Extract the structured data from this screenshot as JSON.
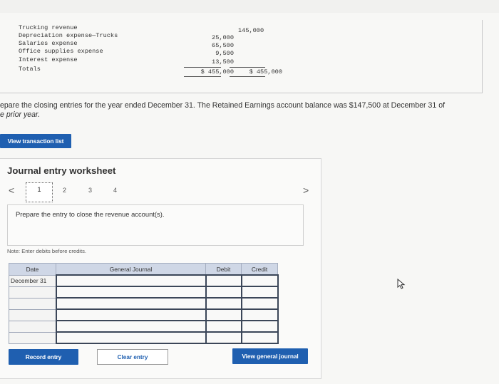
{
  "trial_balance": {
    "rows": [
      {
        "label": "Trucking revenue",
        "debit": "",
        "credit": "145,000"
      },
      {
        "label": "Depreciation expense—Trucks",
        "debit": "25,000",
        "credit": ""
      },
      {
        "label": "Salaries expense",
        "debit": "65,500",
        "credit": ""
      },
      {
        "label": "Office supplies expense",
        "debit": "9,500",
        "credit": ""
      },
      {
        "label": "Interest expense",
        "debit": "13,500",
        "credit": ""
      },
      {
        "label": "Totals",
        "debit": "$ 455,000",
        "credit": "$ 455,000"
      }
    ]
  },
  "instructions": {
    "line1": "epare the closing entries for the year ended December 31. The Retained Earnings account balance was $147,500 at December 31 of",
    "line2": "e prior year."
  },
  "view_transaction_list": "View transaction list",
  "worksheet": {
    "title": "Journal entry worksheet",
    "pages": [
      "1",
      "2",
      "3",
      "4"
    ],
    "prev": "<",
    "next": ">",
    "prompt": "Prepare the entry to close the revenue account(s).",
    "note": "Note: Enter debits before credits.",
    "columns": {
      "date": "Date",
      "journal": "General Journal",
      "debit": "Debit",
      "credit": "Credit"
    },
    "rows": [
      {
        "date": "December 31",
        "account": "",
        "debit": "",
        "credit": ""
      },
      {
        "date": "",
        "account": "",
        "debit": "",
        "credit": ""
      },
      {
        "date": "",
        "account": "",
        "debit": "",
        "credit": ""
      },
      {
        "date": "",
        "account": "",
        "debit": "",
        "credit": ""
      },
      {
        "date": "",
        "account": "",
        "debit": "",
        "credit": ""
      },
      {
        "date": "",
        "account": "",
        "debit": "",
        "credit": ""
      }
    ]
  },
  "buttons": {
    "record": "Record entry",
    "clear": "Clear entry",
    "view_general_journal": "View general journal"
  },
  "colors": {
    "accent": "#1f5fb0",
    "header_bg": "#cfd7e6"
  }
}
